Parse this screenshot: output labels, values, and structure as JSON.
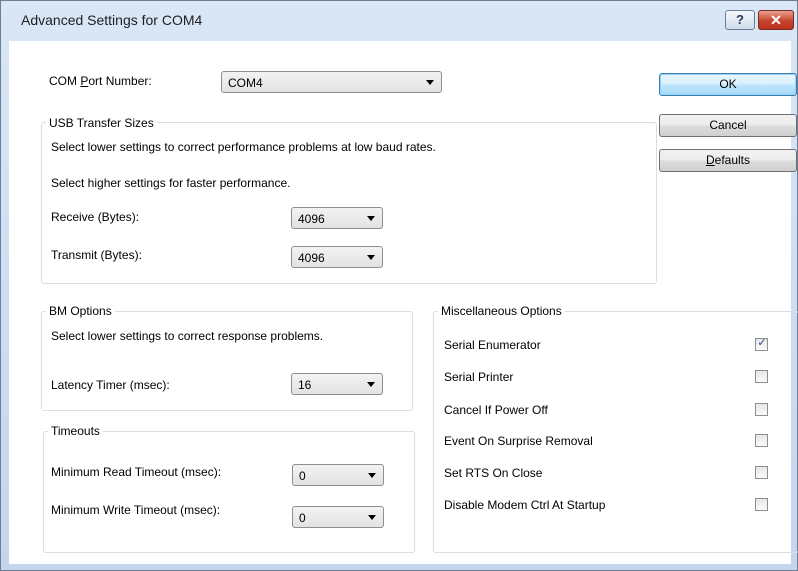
{
  "window": {
    "title": "Advanced Settings for COM4",
    "help_label": "?",
    "close_label": "✕"
  },
  "com_port": {
    "label_pre": "COM ",
    "label_accel": "P",
    "label_post": "ort Number:",
    "value": "COM4"
  },
  "buttons": {
    "ok": "OK",
    "cancel": "Cancel",
    "defaults_accel": "D",
    "defaults_rest": "efaults"
  },
  "usb": {
    "title": "USB Transfer Sizes",
    "desc1": "Select lower settings to correct performance problems at low baud rates.",
    "desc2": "Select higher settings for faster performance.",
    "receive_label": "Receive (Bytes):",
    "receive_value": "4096",
    "transmit_label": "Transmit (Bytes):",
    "transmit_value": "4096"
  },
  "bm": {
    "title": "BM Options",
    "desc": "Select lower settings to correct response problems.",
    "latency_label": "Latency Timer (msec):",
    "latency_value": "16"
  },
  "timeouts": {
    "title": "Timeouts",
    "read_label": "Minimum Read Timeout (msec):",
    "read_value": "0",
    "write_label": "Minimum Write Timeout (msec):",
    "write_value": "0"
  },
  "misc": {
    "title": "Miscellaneous Options",
    "items": [
      {
        "label": "Serial Enumerator",
        "checked": true
      },
      {
        "label": "Serial Printer",
        "checked": false
      },
      {
        "label": "Cancel If Power Off",
        "checked": false
      },
      {
        "label": "Event On Surprise Removal",
        "checked": false
      },
      {
        "label": "Set RTS On Close",
        "checked": false
      },
      {
        "label": "Disable Modem Ctrl At Startup",
        "checked": false
      }
    ],
    "check_glyph": "✓"
  }
}
